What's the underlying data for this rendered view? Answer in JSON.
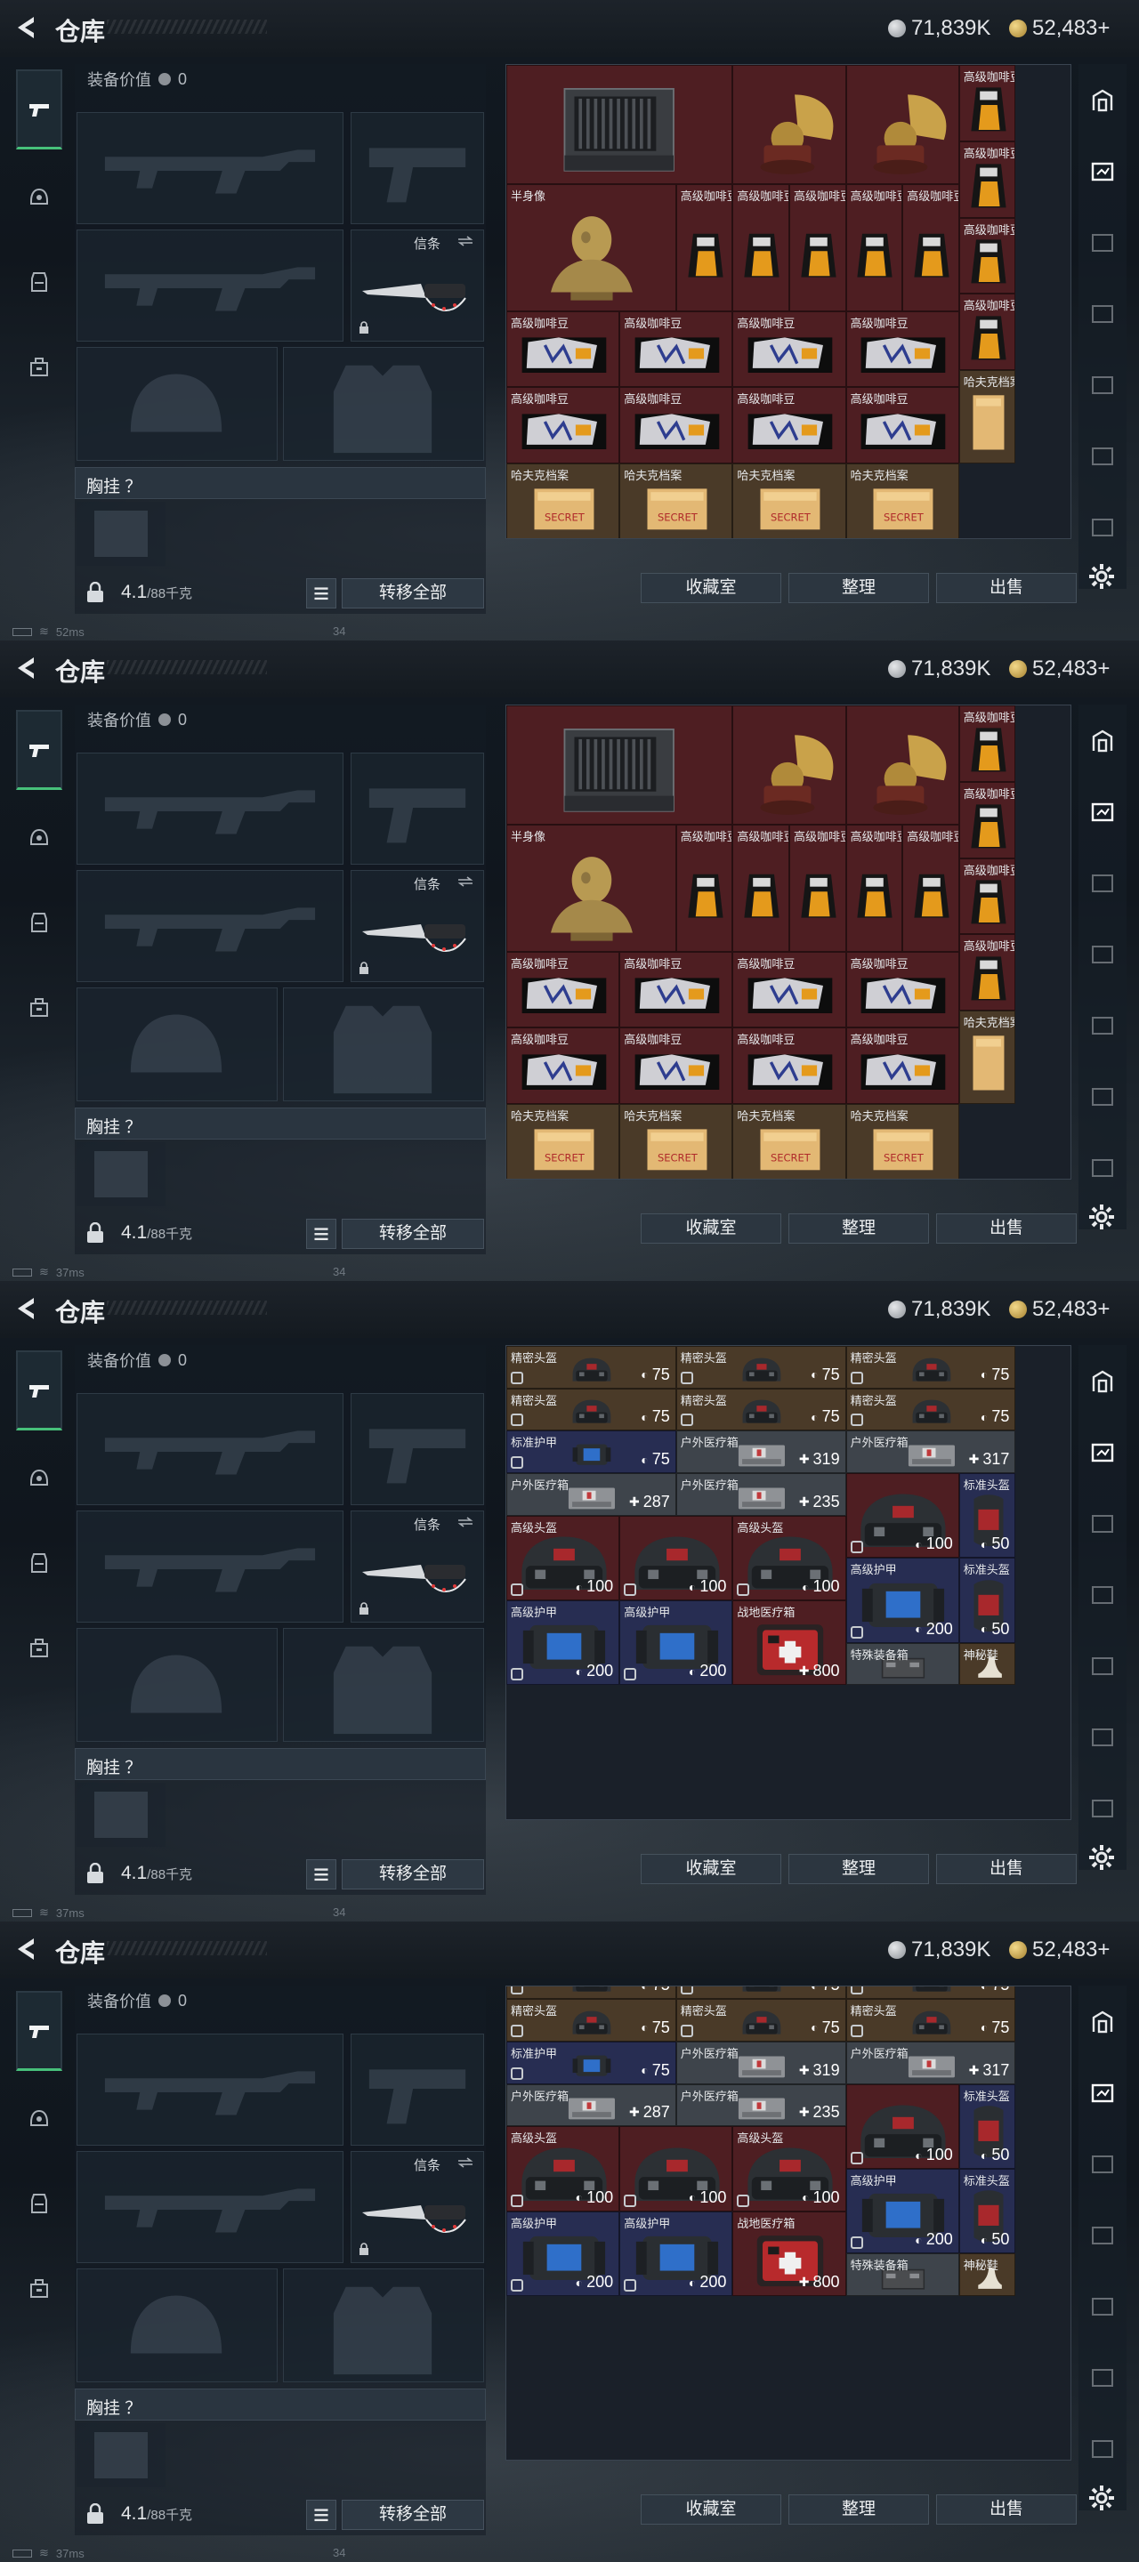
{
  "header": {
    "title": "仓库",
    "silver_amount": "71,839K",
    "gold_amount": "52,483+"
  },
  "equipment": {
    "value_label": "装备价值",
    "value": "0",
    "knife_label": "信条",
    "chest_label": "胸挂 ？",
    "weight_value": "4.1",
    "weight_max": "/88千克",
    "transfer_all": "转移全部"
  },
  "actions": {
    "collection_room": "收藏室",
    "organize": "整理",
    "sell": "出售"
  },
  "status": [
    {
      "ping": "52ms",
      "page": "34"
    },
    {
      "ping": "37ms",
      "page": "34"
    },
    {
      "ping": "37ms",
      "page": "34"
    },
    {
      "ping": "37ms",
      "page": "34"
    }
  ],
  "labels": {
    "bust": "半身像",
    "coffee": "高级咖啡豆",
    "file": "哈夫克档案",
    "helmet_secret": "精密头盔",
    "armor_std": "标准护甲",
    "medkit_outdoor": "户外医疗箱",
    "helmet_adv": "高级头盔",
    "helmet_std": "标准头盔",
    "armor_adv": "高级护甲",
    "medkit_combat": "战地医疗箱",
    "special_box": "特殊装备箱",
    "mystery": "神秘鞋",
    "v75": "75",
    "v319": "319",
    "v317": "317",
    "v287": "287",
    "v235": "235",
    "v100": "100",
    "v50": "50",
    "v200": "200",
    "v800": "800"
  },
  "colors": {
    "cell_red": "#4e1e22",
    "cell_brown": "#4a3a28",
    "cell_blue": "#272d52",
    "accent_green": "#47c07a"
  }
}
